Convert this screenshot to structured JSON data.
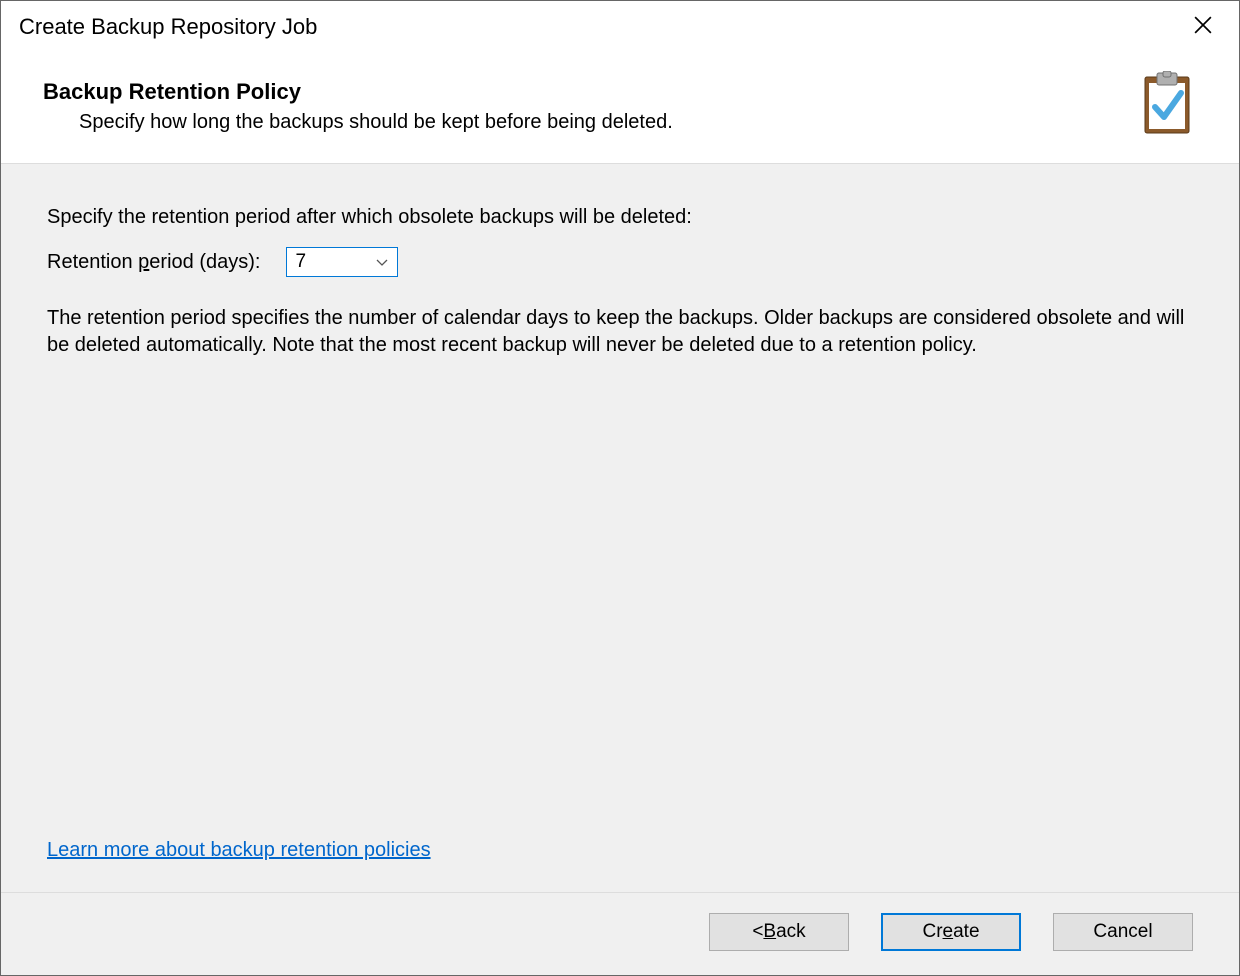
{
  "titlebar": {
    "title": "Create Backup Repository Job"
  },
  "header": {
    "title": "Backup Retention Policy",
    "subtitle": "Specify how long the backups should be kept before being deleted."
  },
  "content": {
    "intro": "Specify the retention period after which obsolete backups will be deleted:",
    "field_label_pre": "Retention ",
    "field_label_u": "p",
    "field_label_post": "eriod (days):",
    "retention_value": "7",
    "explanation": "The retention period specifies the number of calendar days to keep the backups. Older backups are considered obsolete and will be deleted automatically. Note that the most recent backup will never be deleted due to a retention policy.",
    "learn_more": "Learn more about backup retention policies"
  },
  "footer": {
    "back_pre": "< ",
    "back_u": "B",
    "back_post": "ack",
    "create_pre": "Cr",
    "create_u": "e",
    "create_post": "ate",
    "cancel": "Cancel"
  }
}
